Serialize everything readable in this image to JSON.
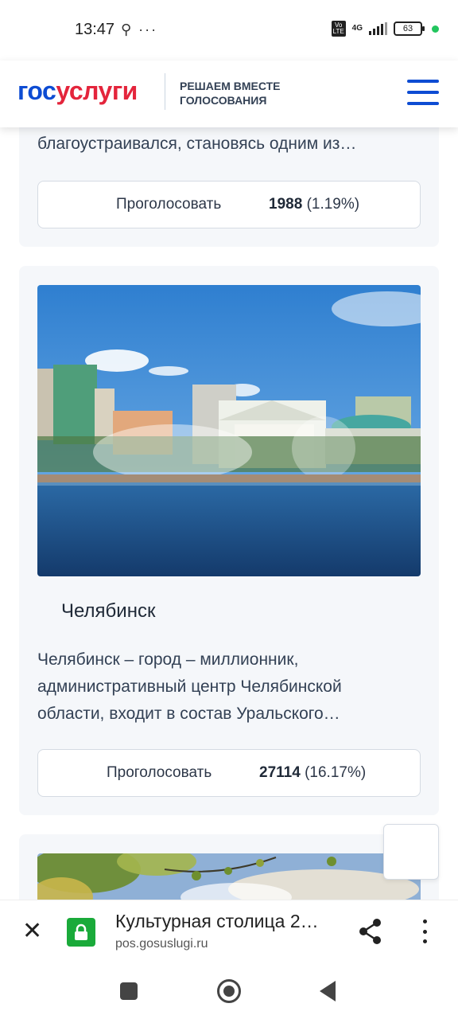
{
  "status_bar": {
    "time": "13:47",
    "left_icons": "⚲ ···",
    "volte": "Vo LTE",
    "network": "4G",
    "battery": "63"
  },
  "header": {
    "logo_part1": "гос",
    "logo_part2": "услуги",
    "subtitle_line1": "РЕШАЕМ ВМЕСТЕ",
    "subtitle_line2": "ГОЛОСОВАНИЯ"
  },
  "cards": [
    {
      "text_partial": "благоустраивался, становясь одним из…",
      "vote_label": "Проголосовать",
      "votes": "1988",
      "percent": "(1.19%)"
    },
    {
      "title": "Челябинск",
      "description": "Челябинск – город – миллионник, административный центр Челябинской области, входит в состав Уральского…",
      "vote_label": "Проголосовать",
      "votes": "27114",
      "percent": "(16.17%)"
    }
  ],
  "browser": {
    "page_title": "Культурная столица 2…",
    "url": "pos.gosuslugi.ru"
  },
  "colors": {
    "brand_blue": "#0d4cd3",
    "brand_red": "#e4253c",
    "card_bg": "#f5f7fa",
    "lock_green": "#1aaa3a"
  },
  "icons": [
    "lock-icon",
    "close-icon",
    "share-icon",
    "more-vert-icon",
    "menu-icon"
  ]
}
